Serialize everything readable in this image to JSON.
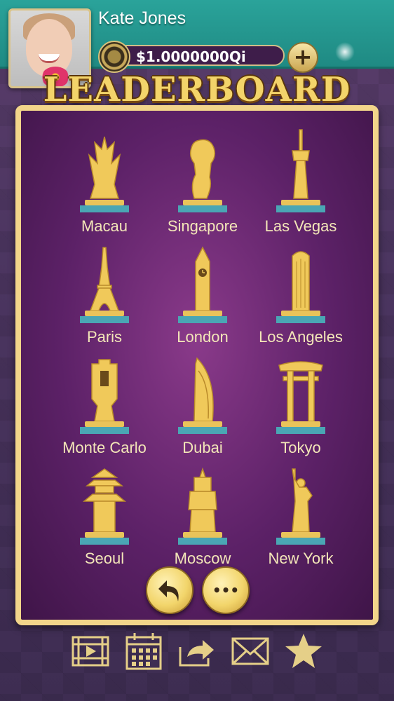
{
  "player": {
    "name": "Kate Jones",
    "balance": "$1.0000000Qi"
  },
  "header": {
    "add_funds_symbol": "+",
    "title": "LEADERBOARD"
  },
  "cities": [
    {
      "label": "Macau",
      "icon": "macau-tower-icon"
    },
    {
      "label": "Singapore",
      "icon": "merlion-icon"
    },
    {
      "label": "Las Vegas",
      "icon": "stratosphere-tower-icon"
    },
    {
      "label": "Paris",
      "icon": "eiffel-tower-icon"
    },
    {
      "label": "London",
      "icon": "big-ben-icon"
    },
    {
      "label": "Los Angeles",
      "icon": "skyscraper-icon"
    },
    {
      "label": "Monte Carlo",
      "icon": "casino-building-icon"
    },
    {
      "label": "Dubai",
      "icon": "burj-al-arab-icon"
    },
    {
      "label": "Tokyo",
      "icon": "torii-gate-icon"
    },
    {
      "label": "Seoul",
      "icon": "pagoda-icon"
    },
    {
      "label": "Moscow",
      "icon": "kremlin-tower-icon"
    },
    {
      "label": "New York",
      "icon": "statue-of-liberty-icon"
    }
  ],
  "controls": {
    "back_icon": "back-arrow-icon",
    "more_symbol": "•••"
  },
  "bottom_nav": [
    {
      "icon": "video-icon"
    },
    {
      "icon": "calendar-icon"
    },
    {
      "icon": "share-icon"
    },
    {
      "icon": "mail-icon"
    },
    {
      "icon": "star-icon"
    }
  ],
  "colors": {
    "gold": "#f0c95a",
    "teal": "#2aa39a",
    "purple": "#5c2167"
  }
}
